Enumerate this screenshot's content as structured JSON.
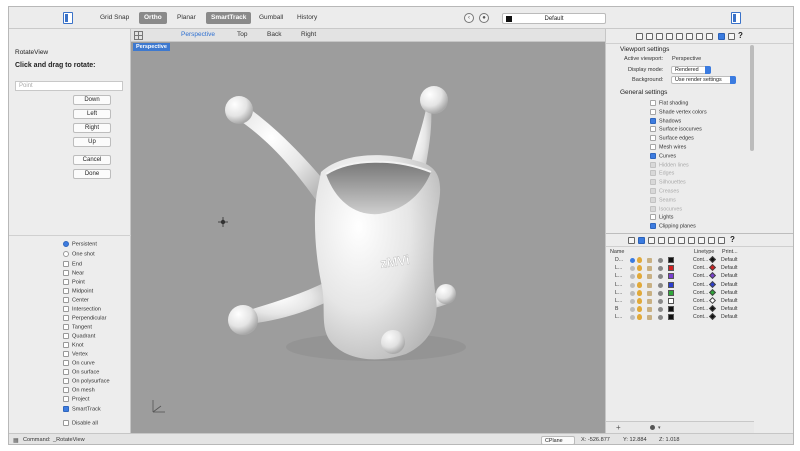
{
  "toolbar": {
    "grid_snap": "Grid Snap",
    "ortho": "Ortho",
    "planar": "Planar",
    "smarttrack": "SmartTrack",
    "gumball": "Gumball",
    "history": "History",
    "layer": "Default"
  },
  "left_panel": {
    "title": "RotateView",
    "instruction": "Click and drag to rotate:",
    "point_placeholder": "Point",
    "buttons": [
      "Down",
      "Left",
      "Right",
      "Up",
      "Cancel",
      "Done"
    ],
    "osnaps": [
      {
        "label": "Persistent",
        "type": "radio",
        "checked": true
      },
      {
        "label": "One shot",
        "type": "radio",
        "checked": false
      },
      {
        "label": "End",
        "type": "check",
        "checked": false
      },
      {
        "label": "Near",
        "type": "check",
        "checked": false
      },
      {
        "label": "Point",
        "type": "check",
        "checked": false
      },
      {
        "label": "Midpoint",
        "type": "check",
        "checked": false
      },
      {
        "label": "Center",
        "type": "check",
        "checked": false
      },
      {
        "label": "Intersection",
        "type": "check",
        "checked": false
      },
      {
        "label": "Perpendicular",
        "type": "check",
        "checked": false
      },
      {
        "label": "Tangent",
        "type": "check",
        "checked": false
      },
      {
        "label": "Quadrant",
        "type": "check",
        "checked": false
      },
      {
        "label": "Knot",
        "type": "check",
        "checked": false
      },
      {
        "label": "Vertex",
        "type": "check",
        "checked": false
      },
      {
        "label": "On curve",
        "type": "check",
        "checked": false
      },
      {
        "label": "On surface",
        "type": "check",
        "checked": false
      },
      {
        "label": "On polysurface",
        "type": "check",
        "checked": false
      },
      {
        "label": "On mesh",
        "type": "check",
        "checked": false
      },
      {
        "label": "Project",
        "type": "check",
        "checked": false
      },
      {
        "label": "SmartTrack",
        "type": "check",
        "checked": true
      },
      {
        "label": "Disable all",
        "type": "check",
        "checked": false
      }
    ]
  },
  "viewport": {
    "tabs": [
      "Perspective",
      "Top",
      "Back",
      "Right"
    ],
    "label": "Perspective",
    "logo_text": "zMVi"
  },
  "viewport_settings": {
    "title": "Viewport settings",
    "active_viewport_label": "Active viewport:",
    "active_viewport": "Perspective",
    "display_mode_label": "Display mode:",
    "display_mode": "Rendered",
    "background_label": "Background:",
    "background": "Use render settings",
    "general_title": "General settings",
    "options": [
      {
        "label": "Flat shading",
        "state": "off"
      },
      {
        "label": "Shade vertex colors",
        "state": "off"
      },
      {
        "label": "Shadows",
        "state": "on"
      },
      {
        "label": "Surface isocurves",
        "state": "off"
      },
      {
        "label": "Surface edges",
        "state": "off"
      },
      {
        "label": "Mesh wires",
        "state": "off"
      },
      {
        "label": "Curves",
        "state": "on"
      },
      {
        "label": "Hidden lines",
        "state": "dim"
      },
      {
        "label": "Edges",
        "state": "dim"
      },
      {
        "label": "Silhouettes",
        "state": "dim"
      },
      {
        "label": "Creases",
        "state": "dim"
      },
      {
        "label": "Seams",
        "state": "dim"
      },
      {
        "label": "Isocurves",
        "state": "dim"
      },
      {
        "label": "Lights",
        "state": "off"
      },
      {
        "label": "Clipping planes",
        "state": "on"
      }
    ]
  },
  "layers": {
    "headers": {
      "name": "Name",
      "linetype": "Linetype",
      "print": "Print..."
    },
    "rows": [
      {
        "name": "D...",
        "color": "#111111",
        "linetype": "Cont...",
        "print_color": "#111111",
        "print": "Default"
      },
      {
        "name": "L...",
        "color": "#d12020",
        "linetype": "Cont...",
        "print_color": "#d12020",
        "print": "Default"
      },
      {
        "name": "L...",
        "color": "#7a3fd0",
        "linetype": "Cont...",
        "print_color": "#7a3fd0",
        "print": "Default"
      },
      {
        "name": "L...",
        "color": "#2c3fd0",
        "linetype": "Cont...",
        "print_color": "#2c3fd0",
        "print": "Default"
      },
      {
        "name": "L...",
        "color": "#2fa83a",
        "linetype": "Cont...",
        "print_color": "#2fa83a",
        "print": "Default"
      },
      {
        "name": "L...",
        "color": "#ffffff",
        "linetype": "Cont...",
        "print_color": "#ffffff",
        "print": "Default"
      },
      {
        "name": "B",
        "color": "#111111",
        "linetype": "Cont...",
        "print_color": "#111111",
        "print": "Default"
      },
      {
        "name": "L...",
        "color": "#111111",
        "linetype": "Cont...",
        "print_color": "#111111",
        "print": "Default"
      }
    ]
  },
  "status": {
    "command_label": "Command:",
    "command": "_RotateView",
    "cplane": "CPlane",
    "x": "X: -526.877",
    "y": "Y: 12.884",
    "z": "Z: 1.018"
  }
}
